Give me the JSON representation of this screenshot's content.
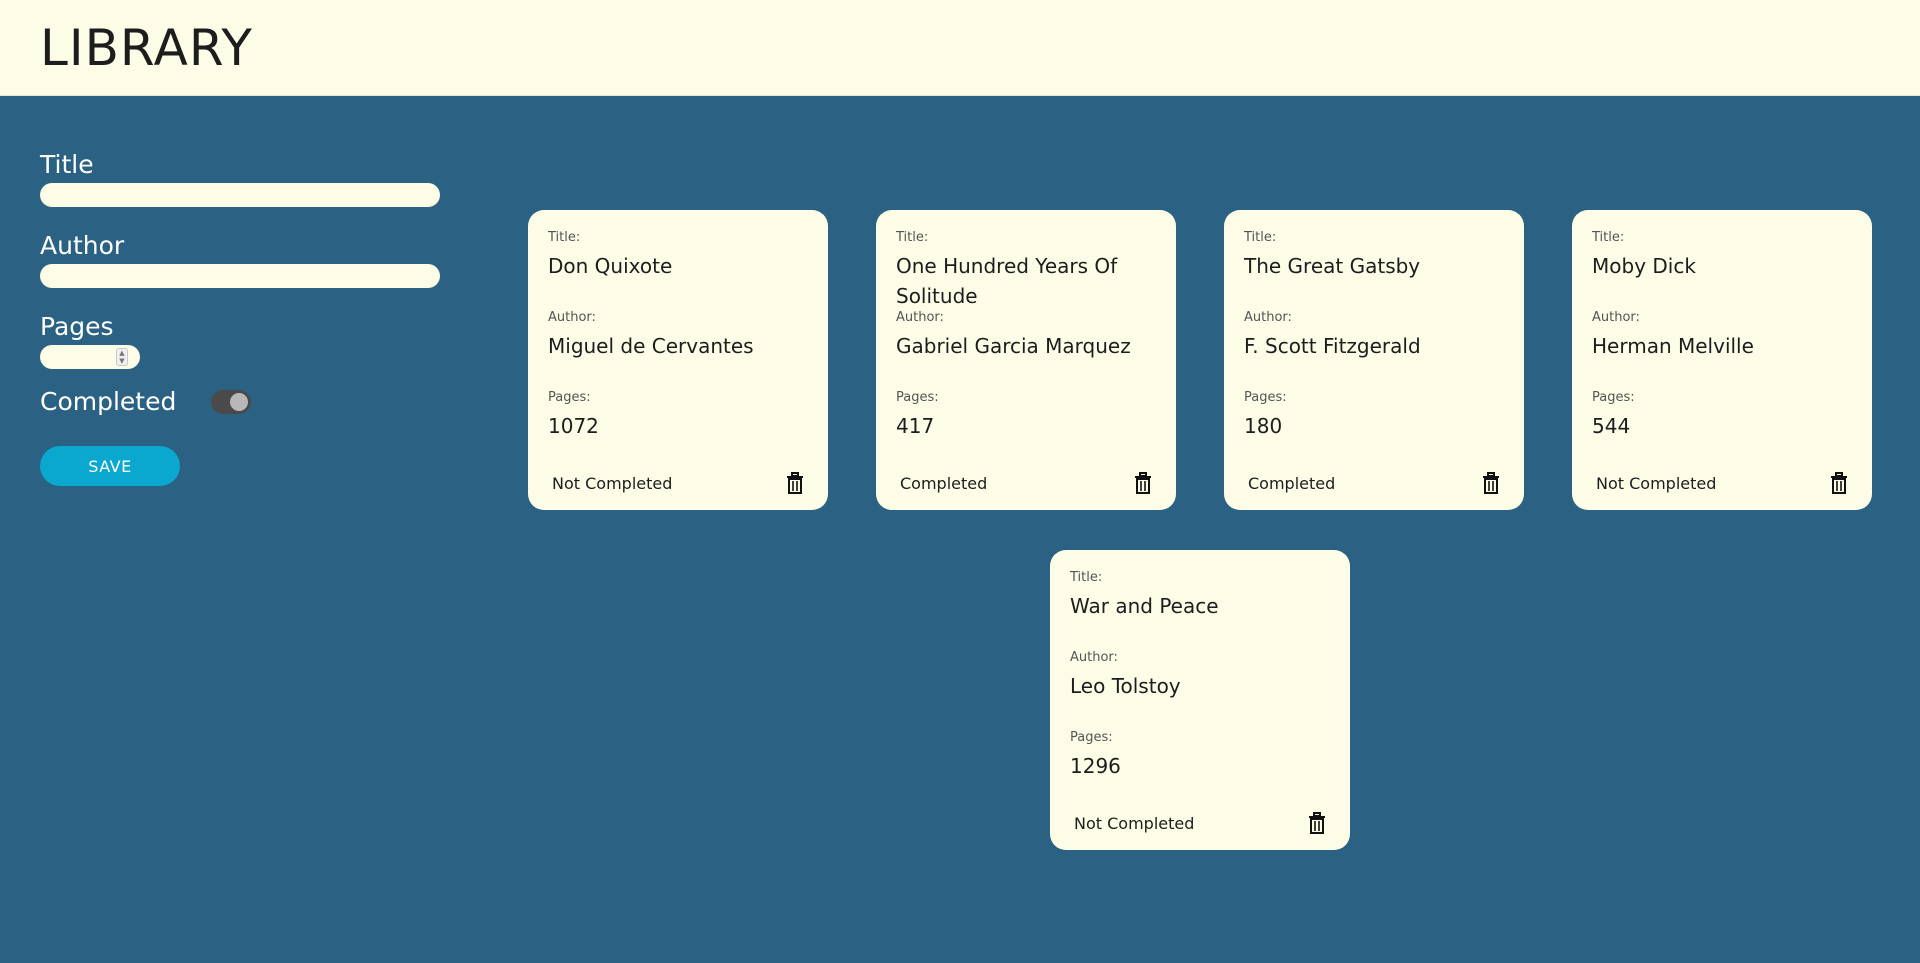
{
  "header": {
    "title": "LIBRARY"
  },
  "form": {
    "title_label": "Title",
    "author_label": "Author",
    "pages_label": "Pages",
    "completed_label": "Completed",
    "save_label": "SAVE"
  },
  "card_labels": {
    "title": "Title:",
    "author": "Author:",
    "pages": "Pages:"
  },
  "books": [
    {
      "title": "Don Quixote",
      "author": "Miguel de Cervantes",
      "pages": "1072",
      "status": "Not Completed"
    },
    {
      "title": "One Hundred Years Of Solitude",
      "author": "Gabriel Garcia Marquez",
      "pages": "417",
      "status": "Completed"
    },
    {
      "title": "The Great Gatsby",
      "author": "F. Scott Fitzgerald",
      "pages": "180",
      "status": "Completed"
    },
    {
      "title": "Moby Dick",
      "author": "Herman Melville",
      "pages": "544",
      "status": "Not Completed"
    },
    {
      "title": "War and Peace",
      "author": "Leo Tolstoy",
      "pages": "1296",
      "status": "Not Completed"
    }
  ],
  "colors": {
    "background": "#2b6283",
    "card": "#fdfce6",
    "accent": "#0aa7cf"
  }
}
